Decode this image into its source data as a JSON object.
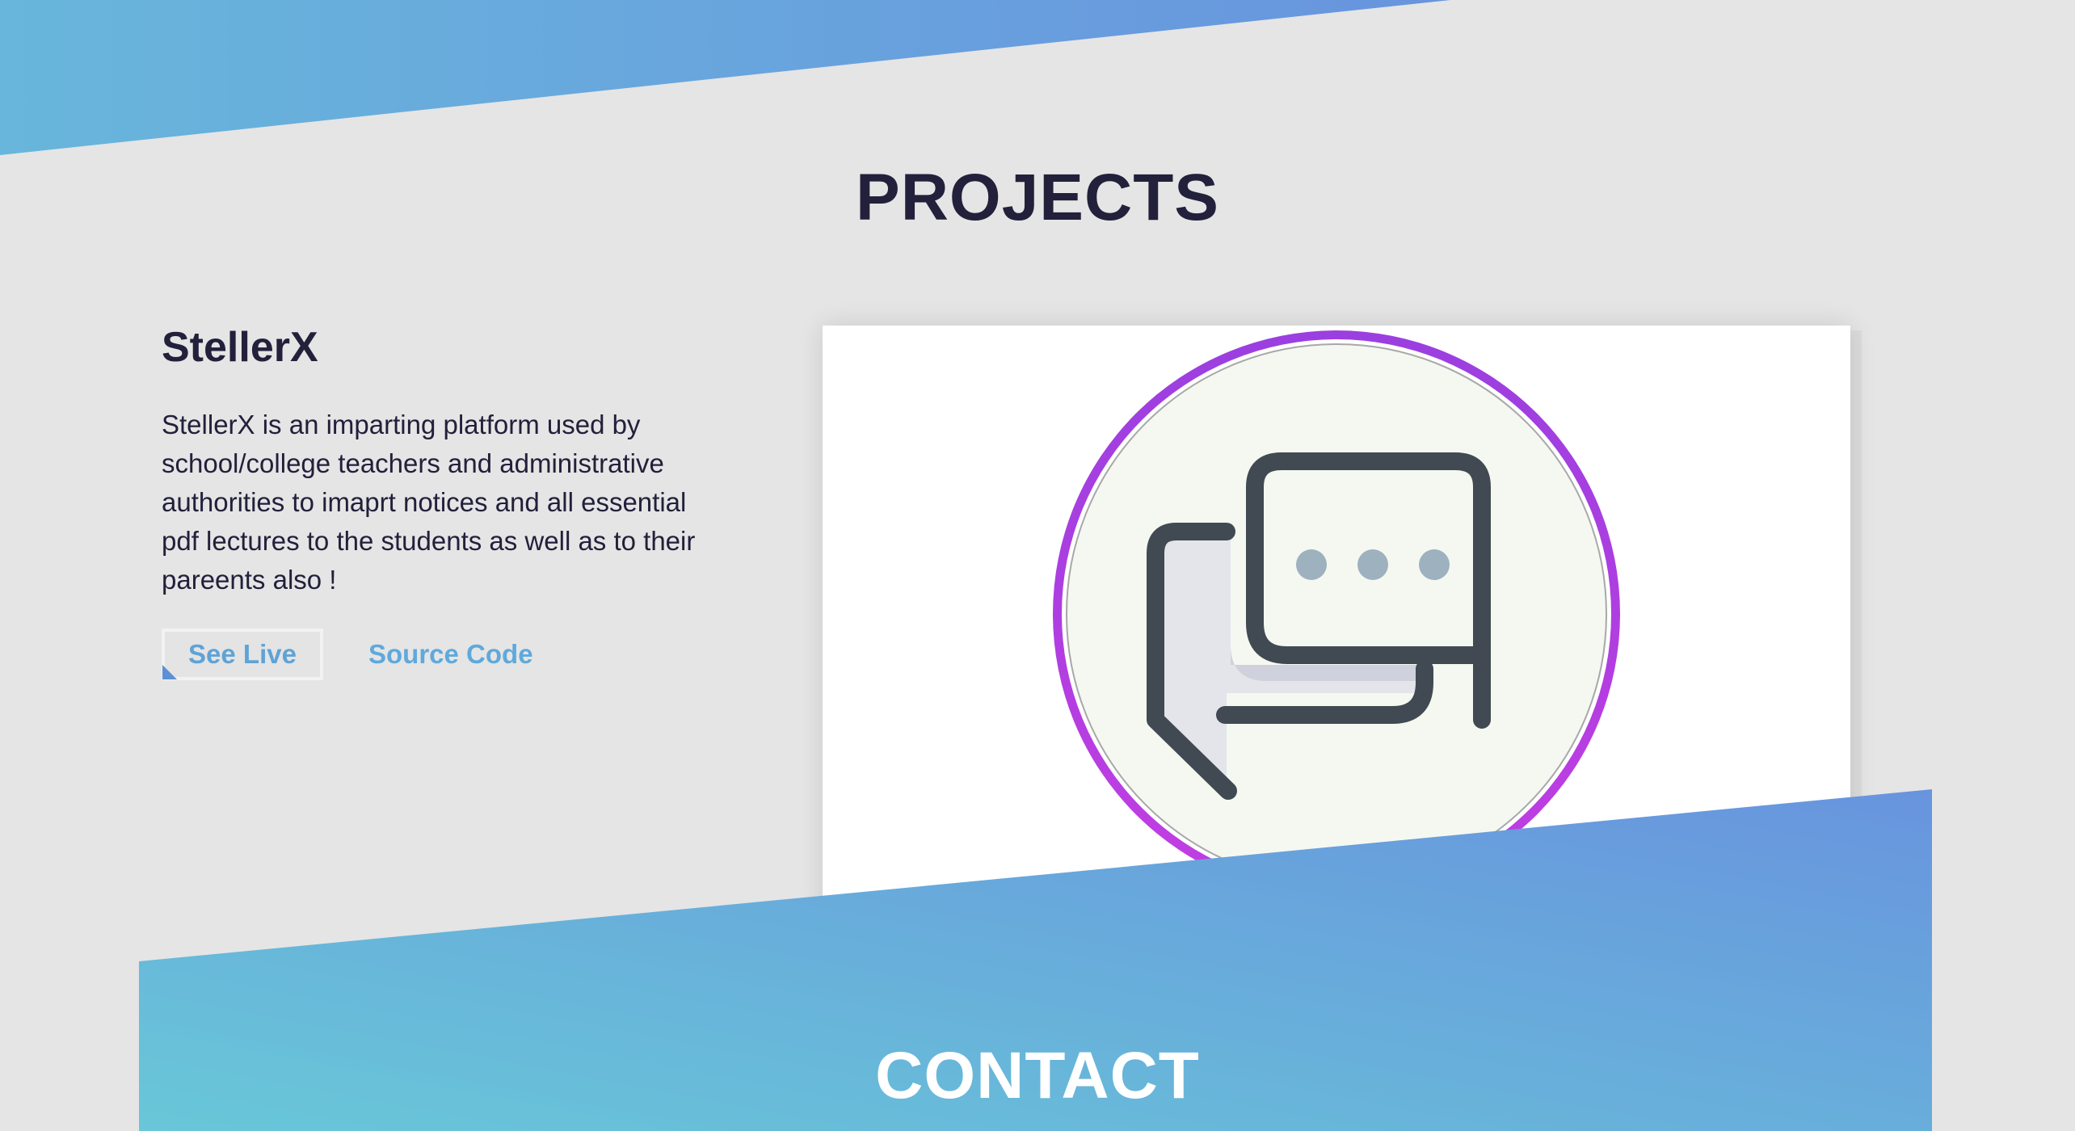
{
  "colors": {
    "background": "#e5e5e5",
    "gradient_start": "#68c7d8",
    "gradient_end": "#6894de",
    "heading": "#22203a",
    "link": "#5fa9dc",
    "logo_ring": "#a93ee0"
  },
  "projects": {
    "title": "PROJECTS",
    "items": [
      {
        "name": "StellerX",
        "description": "StellerX is an imparting platform used by school/college teachers and administrative authorities to imaprt notices and all essential pdf lectures to the students as well as to their pareents also !",
        "see_live_label": "See Live",
        "source_code_label": "Source Code",
        "image_icon": "chat-bubbles-icon"
      }
    ]
  },
  "contact": {
    "title": "CONTACT"
  }
}
